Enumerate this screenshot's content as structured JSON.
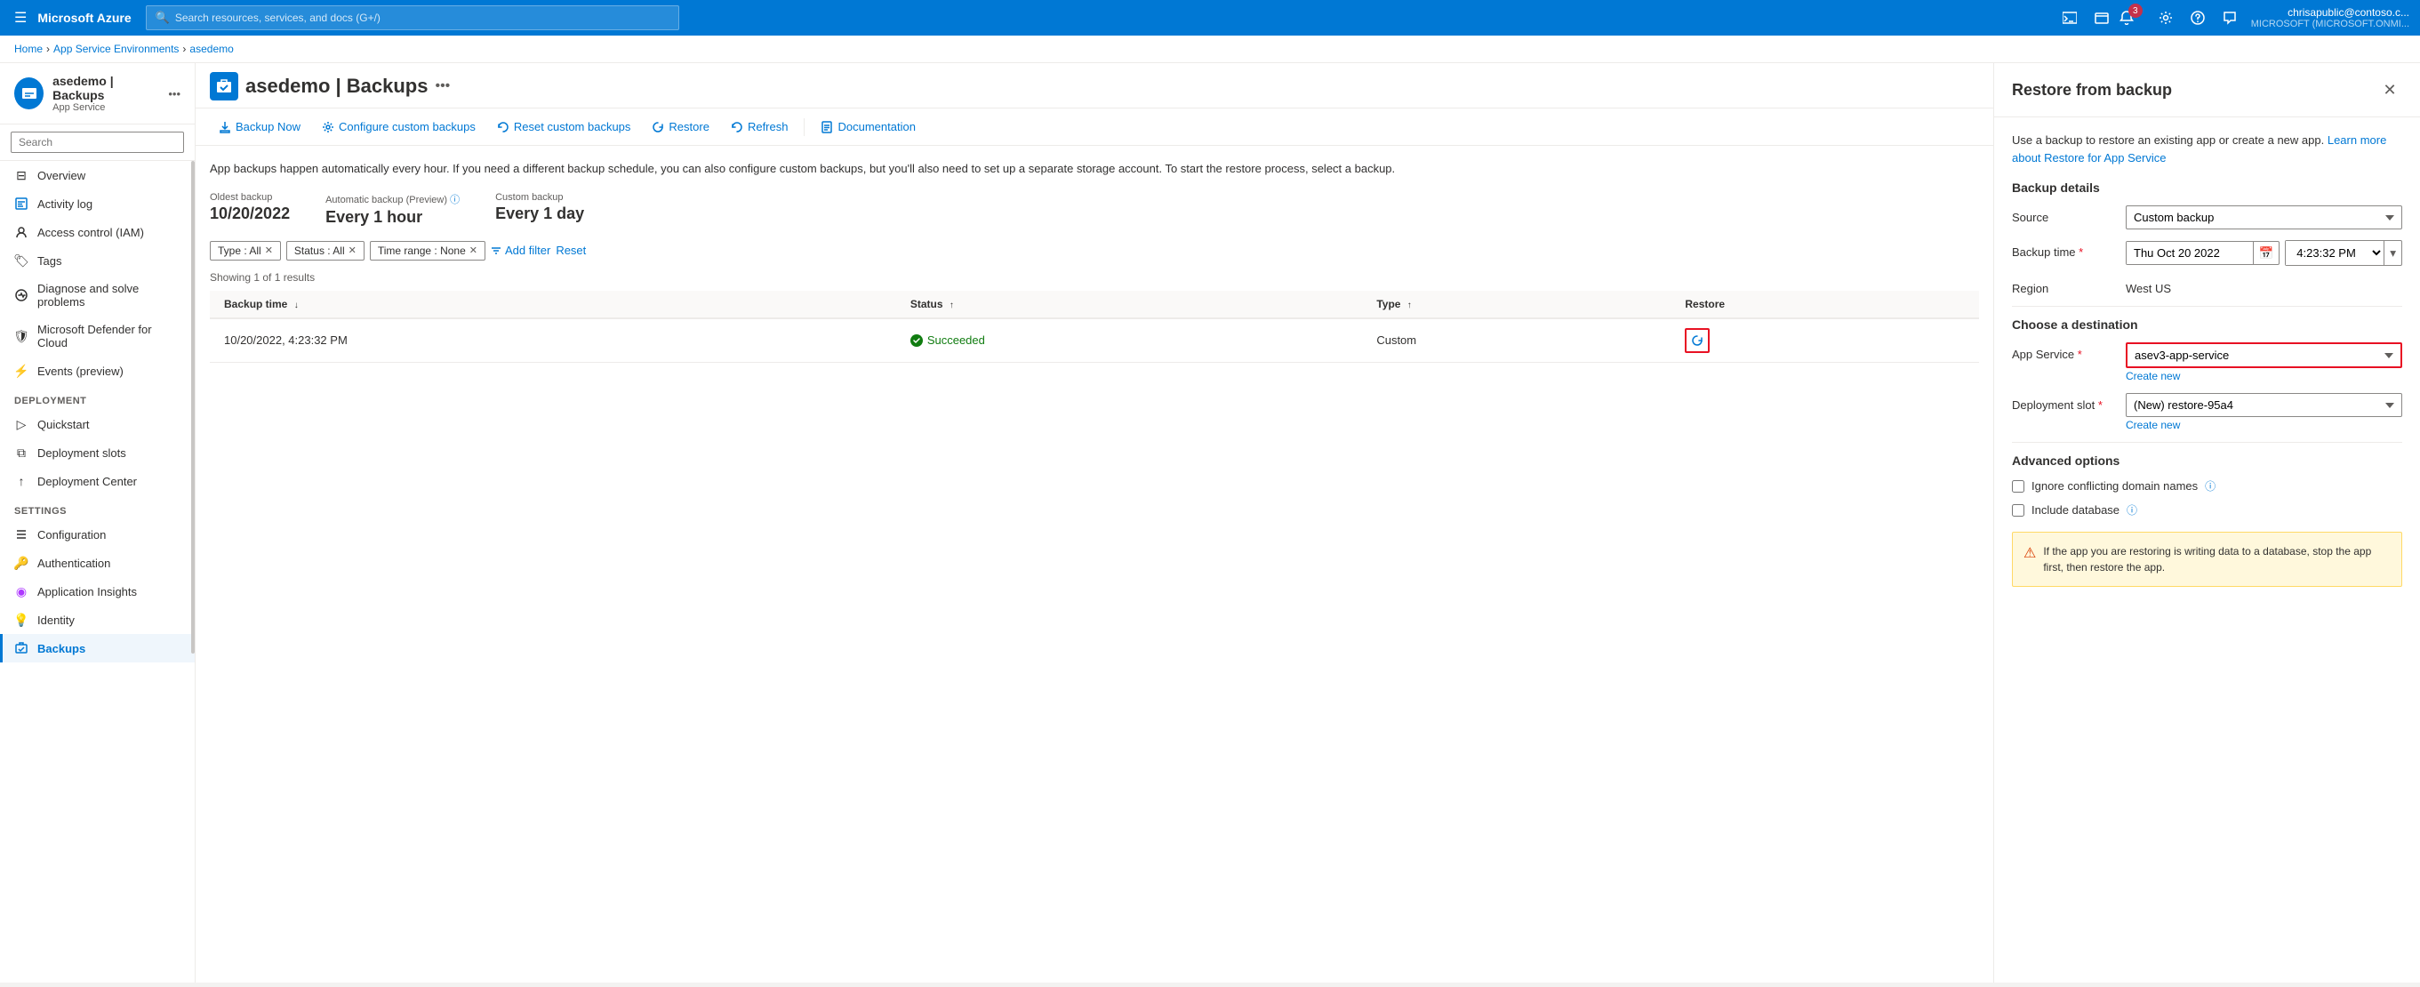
{
  "topnav": {
    "logo": "Microsoft Azure",
    "search_placeholder": "Search resources, services, and docs (G+/)",
    "notification_count": "3",
    "user_name": "chrisapublic@contoso.c...",
    "user_tenant": "MICROSOFT (MICROSOFT.ONMI..."
  },
  "breadcrumb": {
    "home": "Home",
    "separator1": ">",
    "environments": "App Service Environments",
    "separator2": ">",
    "current": "asedemo"
  },
  "sidebar": {
    "app_name": "asedemo | Backups",
    "app_type": "App Service",
    "search_placeholder": "Search",
    "items": [
      {
        "id": "overview",
        "label": "Overview",
        "icon": "⊟"
      },
      {
        "id": "activity-log",
        "label": "Activity log",
        "icon": "≡"
      },
      {
        "id": "access-control",
        "label": "Access control (IAM)",
        "icon": "🔒"
      },
      {
        "id": "tags",
        "label": "Tags",
        "icon": "🏷"
      },
      {
        "id": "diagnose",
        "label": "Diagnose and solve problems",
        "icon": "⚙"
      },
      {
        "id": "defender",
        "label": "Microsoft Defender for Cloud",
        "icon": "🛡"
      },
      {
        "id": "events",
        "label": "Events (preview)",
        "icon": "⚡"
      }
    ],
    "sections": [
      {
        "label": "Deployment",
        "items": [
          {
            "id": "quickstart",
            "label": "Quickstart",
            "icon": "▷"
          },
          {
            "id": "deployment-slots",
            "label": "Deployment slots",
            "icon": "⧉"
          },
          {
            "id": "deployment-center",
            "label": "Deployment Center",
            "icon": "↑"
          }
        ]
      },
      {
        "label": "Settings",
        "items": [
          {
            "id": "configuration",
            "label": "Configuration",
            "icon": "≡"
          },
          {
            "id": "authentication",
            "label": "Authentication",
            "icon": "🔑"
          },
          {
            "id": "app-insights",
            "label": "Application Insights",
            "icon": "◉"
          },
          {
            "id": "identity",
            "label": "Identity",
            "icon": "💡"
          },
          {
            "id": "backups",
            "label": "Backups",
            "icon": "⊞",
            "active": true
          }
        ]
      }
    ]
  },
  "toolbar": {
    "backup_now": "Backup Now",
    "configure": "Configure custom backups",
    "reset": "Reset custom backups",
    "restore": "Restore",
    "refresh": "Refresh",
    "documentation": "Documentation"
  },
  "content": {
    "info_text": "App backups happen automatically every hour. If you need a different backup schedule, you can also configure custom backups, but you'll also need to set up a separate storage account. To start the restore process, select a backup.",
    "oldest_backup_label": "Oldest backup",
    "oldest_backup_value": "10/20/2022",
    "auto_backup_label": "Automatic backup (Preview)",
    "auto_backup_value": "Every 1 hour",
    "custom_backup_label": "Custom backup",
    "custom_backup_value": "Every 1 day",
    "filters": [
      {
        "label": "Type : All"
      },
      {
        "label": "Status : All"
      },
      {
        "label": "Time range : None"
      }
    ],
    "add_filter": "Add filter",
    "reset": "Reset",
    "results_count": "Showing 1 of 1 results",
    "table": {
      "columns": [
        {
          "label": "Backup time",
          "sort": "↓"
        },
        {
          "label": "Status",
          "sort": "↑"
        },
        {
          "label": "Type",
          "sort": "↑"
        },
        {
          "label": "Restore"
        }
      ],
      "rows": [
        {
          "backup_time": "10/20/2022, 4:23:32 PM",
          "status": "Succeeded",
          "type": "Custom"
        }
      ]
    }
  },
  "panel": {
    "title": "Restore from backup",
    "info_text": "Use a backup to restore an existing app or create a new app.",
    "learn_more": "Learn more about Restore for App Service",
    "backup_details_title": "Backup details",
    "source_label": "Source",
    "source_value": "Custom backup",
    "backup_time_label": "Backup time",
    "backup_time_date": "Thu Oct 20 2022",
    "backup_time_time": "4:23:32 PM",
    "region_label": "Region",
    "region_value": "West US",
    "destination_title": "Choose a destination",
    "app_service_label": "App Service",
    "app_service_value": "asev3-app-service",
    "create_new_app": "Create new",
    "deployment_slot_label": "Deployment slot",
    "deployment_slot_value": "(New) restore-95a4",
    "create_new_slot": "Create new",
    "advanced_options_title": "Advanced options",
    "ignore_domain_label": "Ignore conflicting domain names",
    "include_db_label": "Include database",
    "warning_text": "If the app you are restoring is writing data to a database, stop the app first, then restore the app."
  }
}
